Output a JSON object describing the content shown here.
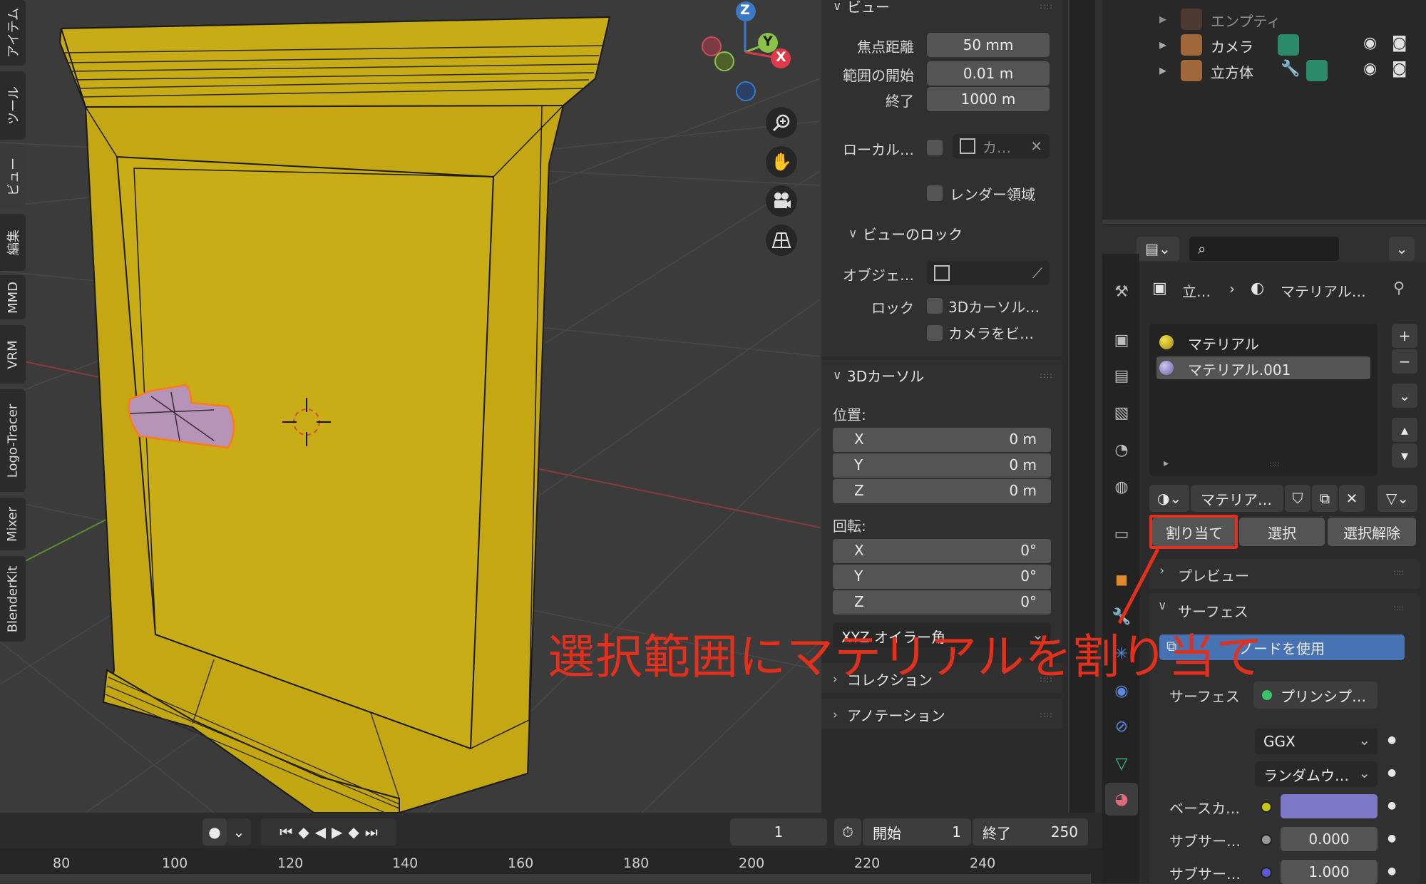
{
  "viewport": {
    "nav_buttons": [
      "zoom-icon",
      "hand-pan-icon",
      "camera-view-icon",
      "perspective-grid-icon"
    ],
    "gizmo": {
      "z": "Z",
      "y": "Y",
      "x": "X"
    }
  },
  "npanel": {
    "view_section": {
      "title": "ビュー",
      "focal_label": "焦点距離",
      "focal_value": "50 mm",
      "clip_start_label": "範囲の開始",
      "clip_start_value": "0.01 m",
      "clip_end_label": "終了",
      "clip_end_value": "1000 m",
      "local_label": "ローカル…",
      "local_value": "カ…",
      "render_region_label": "レンダー領域",
      "lock_title": "ビューのロック",
      "object_label": "オブジェ…",
      "lock_label": "ロック",
      "lock_cursor": "3Dカーソル…",
      "lock_camera": "カメラをビ…"
    },
    "cursor_section": {
      "title": "3Dカーソル",
      "location_label": "位置:",
      "location": [
        {
          "axis": "X",
          "value": "0 m"
        },
        {
          "axis": "Y",
          "value": "0 m"
        },
        {
          "axis": "Z",
          "value": "0 m"
        }
      ],
      "rotation_label": "回転:",
      "rotation": [
        {
          "axis": "X",
          "value": "0°"
        },
        {
          "axis": "Y",
          "value": "0°"
        },
        {
          "axis": "Z",
          "value": "0°"
        }
      ],
      "rotation_mode": "XYZ オイラー角"
    },
    "collection_title": "コレクション",
    "annotation_title": "アノテーション"
  },
  "tabs": [
    "アイテム",
    "ツール",
    "ビュー",
    "編集",
    "MMD",
    "VRM",
    "Logo-Tracer",
    "Mixer",
    "BlenderKit"
  ],
  "outliner": {
    "rows": [
      {
        "label": "エンプティ"
      },
      {
        "label": "カメラ"
      },
      {
        "label": "立方体"
      }
    ]
  },
  "properties": {
    "breadcrumb_object": "立…",
    "breadcrumb_material": "マテリアル…",
    "slots": [
      "マテリアル",
      "マテリアル.001"
    ],
    "material_name": "マテリア…",
    "assign_label": "割り当て",
    "select_label": "選択",
    "deselect_label": "選択解除",
    "preview_title": "プレビュー",
    "surface_title": "サーフェス",
    "use_nodes_label": "ノードを使用",
    "surface_label": "サーフェス",
    "surface_value": "プリンシプ…",
    "distribution": "GGX",
    "subsurface_method": "ランダムウ…",
    "base_color_label": "ベースカ…",
    "base_color": "#7d78c8",
    "subsurface_label": "サブサー…",
    "subsurface_value": "0.000",
    "subsurface_radius_label": "サブサー…",
    "subsurface_radius_value": "1.000"
  },
  "timeline": {
    "current_frame": "1",
    "start_label": "開始",
    "start_value": "1",
    "end_label": "終了",
    "end_value": "250",
    "ticks": [
      "80",
      "100",
      "120",
      "140",
      "160",
      "180",
      "200",
      "220",
      "240"
    ]
  },
  "annotation": {
    "text": "選択範囲にマテリアルを割り当て",
    "color": "#e3301c"
  }
}
